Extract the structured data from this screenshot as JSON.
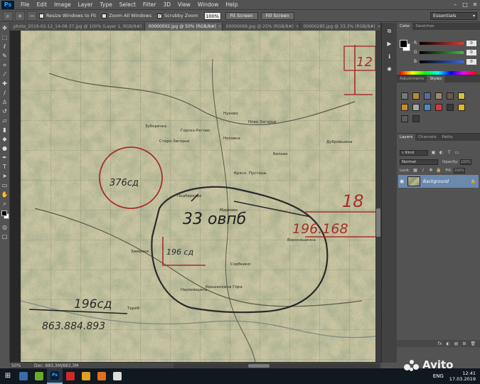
{
  "app": {
    "logo": "Ps",
    "menu": [
      "File",
      "Edit",
      "Image",
      "Layer",
      "Type",
      "Select",
      "Filter",
      "3D",
      "View",
      "Window",
      "Help"
    ],
    "window_controls": [
      "–",
      "□",
      "✕"
    ]
  },
  "options_bar": {
    "resize_windows": "Resize Windows to Fit",
    "zoom_all": "Zoom All Windows",
    "scrubby_zoom": "Scrubby Zoom",
    "zoom_value": "100%",
    "fit_screen": "Fit Screen",
    "fill_screen": "Fill Screen",
    "workspace": "Essentials"
  },
  "tabs": [
    {
      "label": "photo_2019-02-12_14-08-37.jpg @ 100% (Layer 1, RGB/8#)"
    },
    {
      "label": "00000002.jpg @ 50% (RGB/8#)"
    },
    {
      "label": "00000069.jpg @ 25% (RGB/8#)"
    },
    {
      "label": "00000285.jpg @ 33,3% (RGB/8#)"
    }
  ],
  "status": {
    "zoom": "50%",
    "doc": "Doc: 883,3M/883,3M"
  },
  "panels": {
    "color_tabs": [
      "Color",
      "Swatches"
    ],
    "sliders": [
      {
        "label": "R",
        "value": "0",
        "color": "#e03a3a"
      },
      {
        "label": "G",
        "value": "0",
        "color": "#3ac040"
      },
      {
        "label": "B",
        "value": "0",
        "color": "#3a6ae0"
      }
    ],
    "style_tabs": [
      "Adjustments",
      "Styles"
    ],
    "style_colors": [
      "#777777",
      "#b58a3a",
      "#5a6e9a",
      "#a08870",
      "#6a5a48",
      "#d6c23a",
      "#cc8a2a",
      "#a8a8a8",
      "#4a8ac8",
      "#d63a3a",
      "#3a3a3a",
      "#e0b820",
      "#5a5a5a",
      "#3c3c3c"
    ],
    "layers_tabs": [
      "Layers",
      "Channels",
      "Paths"
    ],
    "kind": "Kind",
    "blend": "Normal",
    "opacity_label": "Opacity:",
    "opacity_value": "100%",
    "lock_label": "Lock:",
    "fill_label": "Fill:",
    "fill_value": "100%",
    "layer_name": "Background",
    "bottom_icons": [
      "fx",
      "◐",
      "▤",
      "⊞",
      "🗑"
    ]
  },
  "map_annotations": {
    "a1": "376сд",
    "a2": "33 овпб",
    "a3": "196 сд",
    "a4": "196.168",
    "a5": "18",
    "a6": "12",
    "a7": "196сд",
    "a8": "863.884.893"
  },
  "map_places": [
    "Зуборечка",
    "Горско-Регово",
    "Старо-Загорье",
    "Нуково",
    "Носовка",
    "Ново-Загорье",
    "Бельве",
    "Красн. Пустошь",
    "Подберезье",
    "Марково",
    "Дубровшина",
    "Воронешинка",
    "Зименки",
    "Сорбкино",
    "Наумовщина",
    "Квашенкина Гора",
    "Тереб"
  ],
  "taskbar": {
    "lang": "ENG",
    "time": "12:41",
    "date": "17.03.2019",
    "apps": [
      {
        "label": "",
        "color": "#3a6aa8"
      },
      {
        "label": "",
        "color": "#6aaa2a"
      },
      {
        "label": "Ps",
        "color": "#001e36"
      },
      {
        "label": "",
        "color": "#cc2a2a"
      },
      {
        "label": "",
        "color": "#e0a020"
      },
      {
        "label": "",
        "color": "#e07020"
      },
      {
        "label": "",
        "color": "#dddddd"
      }
    ]
  },
  "watermark": "Avito"
}
